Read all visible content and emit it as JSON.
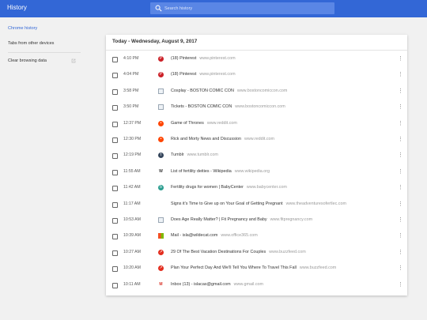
{
  "header": {
    "title": "History",
    "search_placeholder": "Search history"
  },
  "sidebar": {
    "items": [
      {
        "label": "Chrome history"
      },
      {
        "label": "Tabs from other devices"
      },
      {
        "label": "Clear browsing data"
      }
    ]
  },
  "main": {
    "date_header": "Today - Wednesday, August 9, 2017",
    "entries": [
      {
        "time": "4:10 PM",
        "title": "(18) Pinterest",
        "domain": "www.pinterest.com",
        "icon": "pinterest-icon",
        "color": "#cb2027"
      },
      {
        "time": "4:04 PM",
        "title": "(18) Pinterest",
        "domain": "www.pinterest.com",
        "icon": "pinterest-icon",
        "color": "#cb2027"
      },
      {
        "time": "3:58 PM",
        "title": "Cosplay - BOSTON COMIC CON",
        "domain": "www.bostoncomiccon.com",
        "icon": "broken-image-icon",
        "color": "#9aa7b4"
      },
      {
        "time": "3:50 PM",
        "title": "Tickets - BOSTON COMIC CON",
        "domain": "www.bostoncomiccon.com",
        "icon": "broken-image-icon",
        "color": "#9aa7b4"
      },
      {
        "time": "12:37 PM",
        "title": "Game of Thrones",
        "domain": "www.reddit.com",
        "icon": "reddit-icon",
        "color": "#ff4500"
      },
      {
        "time": "12:30 PM",
        "title": "Rick and Morty News and Discussion",
        "domain": "www.reddit.com",
        "icon": "reddit-icon",
        "color": "#ff4500"
      },
      {
        "time": "12:19 PM",
        "title": "Tumblr",
        "domain": "www.tumblr.com",
        "icon": "tumblr-icon",
        "color": "#35465c"
      },
      {
        "time": "11:55 AM",
        "title": "List of fertility deities - Wikipedia",
        "domain": "www.wikipedia.org",
        "icon": "wikipedia-icon",
        "color": "#333333"
      },
      {
        "time": "11:42 AM",
        "title": "Fertility drugs for women | BabyCenter",
        "domain": "www.babycenter.com",
        "icon": "babycenter-icon",
        "color": "#2a9d8f"
      },
      {
        "time": "11:17 AM",
        "title": "Signs it's Time to Give up on Your Goal of Getting Pregnant",
        "domain": "www.theadventuresofertlec.com",
        "icon": "",
        "color": ""
      },
      {
        "time": "10:53 AM",
        "title": "Does Age Really Matter? | Fit Pregnancy and Baby",
        "domain": "www.fitpregnancy.com",
        "icon": "broken-image-icon",
        "color": "#9aa7b4"
      },
      {
        "time": "10:39 AM",
        "title": "Mail - isla@wildecat.com",
        "domain": "www.office365.com",
        "icon": "office-icon",
        "color": "#f25022"
      },
      {
        "time": "10:27 AM",
        "title": "29 Of The Best Vacation Destinations For Couples",
        "domain": "www.buzzfeed.com",
        "icon": "buzzfeed-icon",
        "color": "#e32c1d"
      },
      {
        "time": "10:20 AM",
        "title": "Plan Your Perfect Day And We'll Tell You Where To Travel This Fall",
        "domain": "www.buzzfeed.com",
        "icon": "buzzfeed-icon",
        "color": "#e32c1d"
      },
      {
        "time": "10:11 AM",
        "title": "Inbox (13) - islacas@gmail.com",
        "domain": "www.gmail.com",
        "icon": "gmail-icon",
        "color": "#d93025"
      }
    ]
  }
}
